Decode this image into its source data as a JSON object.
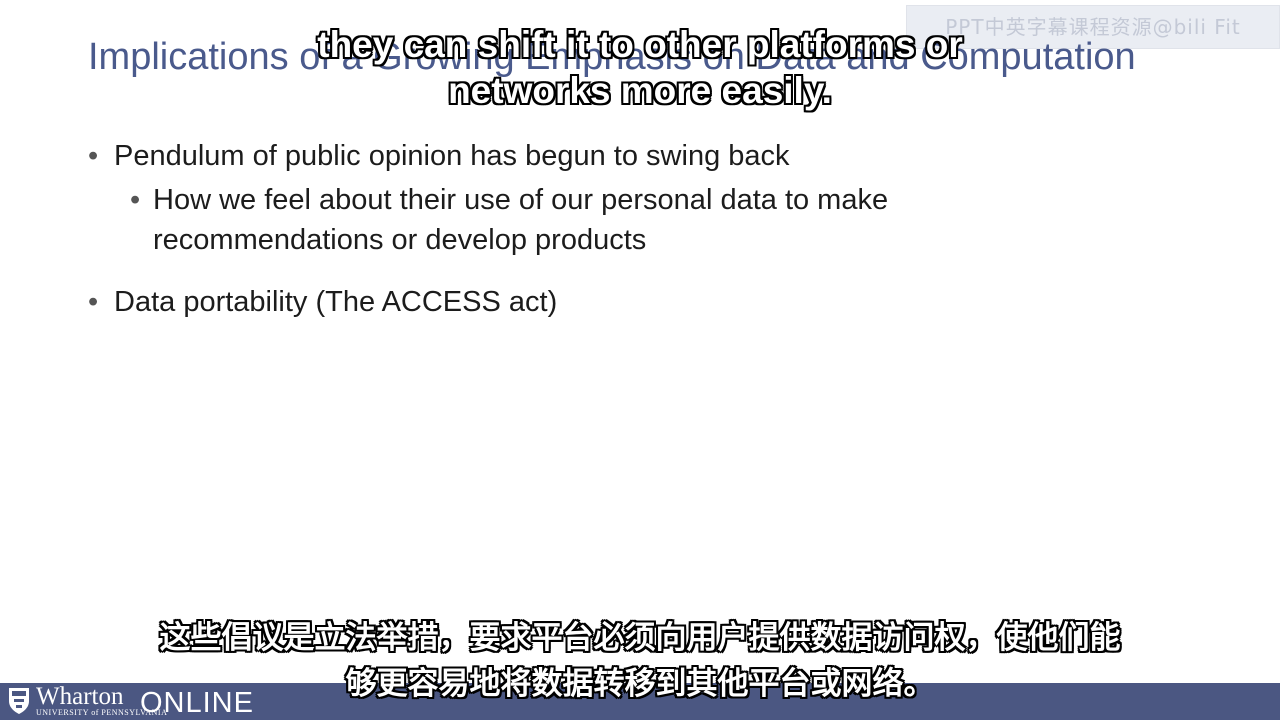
{
  "watermark": "PPT中英字幕课程资源@bili Fit",
  "slide": {
    "title": "Implications of a Growing Emphasis on Data and Computation",
    "bullets": [
      {
        "level": 1,
        "text": "Pendulum of public opinion has begun to swing back"
      },
      {
        "level": 2,
        "text": "How we feel about their use of our personal data to make recommendations or develop products"
      },
      {
        "level": 1,
        "text": "Data portability (The ACCESS act)"
      }
    ],
    "bullet_glyph": "•"
  },
  "subtitles": {
    "english": [
      "they can shift it to other platforms or",
      "networks more easily."
    ],
    "chinese": [
      "这些倡议是立法举措，要求平台必须向用户提供数据访问权，使他们能",
      "够更容易地将数据转移到其他平台或网络。"
    ]
  },
  "footer": {
    "brand": "Wharton",
    "brand_sub": "UNIVERSITY of PENNSYLVANIA",
    "product": "ONLINE",
    "background": "#4b5782"
  }
}
